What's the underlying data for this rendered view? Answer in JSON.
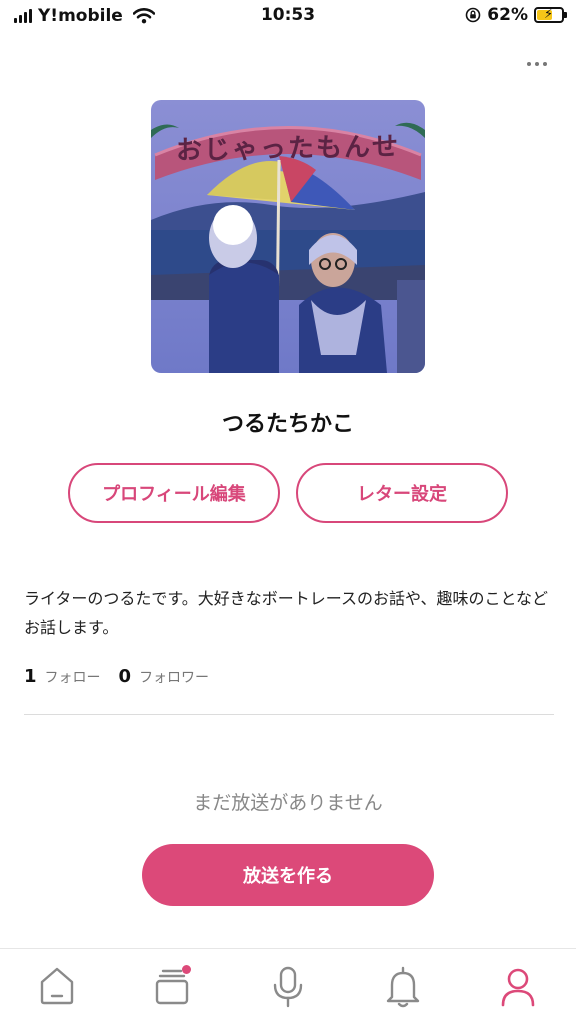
{
  "status_bar": {
    "carrier": "Y!mobile",
    "time": "10:53",
    "battery_percent": "62%",
    "battery_level": 0.62,
    "icons": [
      "signal-icon",
      "wifi-icon",
      "rotation-lock-icon",
      "battery-charging-icon"
    ]
  },
  "header": {
    "more_icon": "more-horizontal-icon"
  },
  "profile": {
    "name": "つるたちかこ",
    "avatar_caption": "おじゃったもんせ",
    "bio": "ライターのつるたです。大好きなボートレースのお話や、趣味のことなどお話します。",
    "following_count": "1",
    "following_label": "フォロー",
    "followers_count": "0",
    "followers_label": "フォロワー"
  },
  "actions": {
    "edit_profile": "プロフィール編集",
    "letter_settings": "レター設定"
  },
  "broadcasts": {
    "empty_message": "まだ放送がありません",
    "create_button": "放送を作る"
  },
  "bottom_nav": {
    "items": [
      {
        "icon": "home-icon",
        "active": false
      },
      {
        "icon": "library-icon",
        "active": false,
        "badge": true
      },
      {
        "icon": "microphone-icon",
        "active": false
      },
      {
        "icon": "bell-icon",
        "active": false
      },
      {
        "icon": "profile-icon",
        "active": true
      }
    ]
  },
  "colors": {
    "accent": "#dc4979",
    "inactive_icon": "#8a8a8a"
  }
}
